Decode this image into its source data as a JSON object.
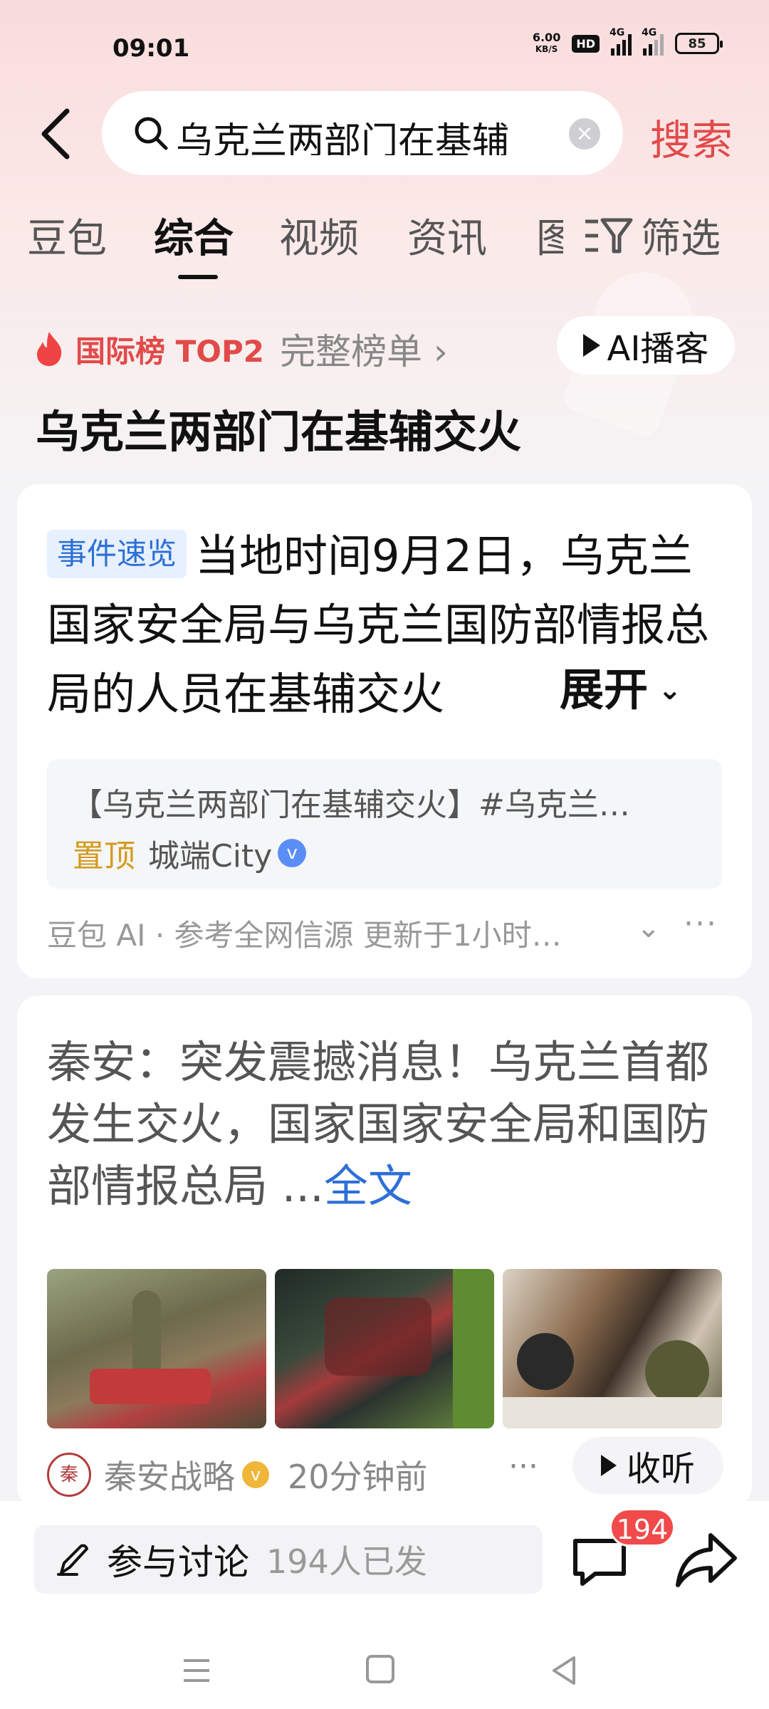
{
  "status": {
    "time": "09:01",
    "speed_value": "6.00",
    "speed_unit": "KB/S",
    "hd": "HD",
    "sig1": "4G",
    "sig2": "4G",
    "battery": "85"
  },
  "search": {
    "query": "乌克兰两部门在基辅",
    "button": "搜索"
  },
  "tabs": [
    "豆包",
    "综合",
    "视频",
    "资讯"
  ],
  "tab_partial": "图",
  "filter_label": "筛选",
  "rank": {
    "title": "国际榜 TOP2",
    "full_list": "完整榜单 ›",
    "ai_podcast": "AI播客"
  },
  "headline": "乌克兰两部门在基辅交火",
  "card1": {
    "tag": "事件速览",
    "summary": "当地时间9月2日，乌克兰国家安全局与乌克兰国防部情报总局的人员在基辅交火",
    "expand": "展开",
    "pinned_text": "【乌克兰两部门在基辅交火】#乌克兰…",
    "pinned_label": "置顶",
    "pinned_source": "城端City",
    "footer": "豆包 AI · 参考全网信源 更新于1小时…"
  },
  "card2": {
    "text": "秦安：突发震撼消息！乌克兰首都发生交火，国家国家安全局和国防部情报总局 ...",
    "full_link": "全文",
    "author": "秦安战略",
    "time": "20分钟前",
    "listen": "收听"
  },
  "bottom": {
    "discuss_label": "参与讨论",
    "discuss_count": "194人已发",
    "comment_badge": "194"
  },
  "colors": {
    "accent_red": "#e24a4a",
    "link_blue": "#2d6fd6",
    "pin_gold": "#d49a1f"
  }
}
